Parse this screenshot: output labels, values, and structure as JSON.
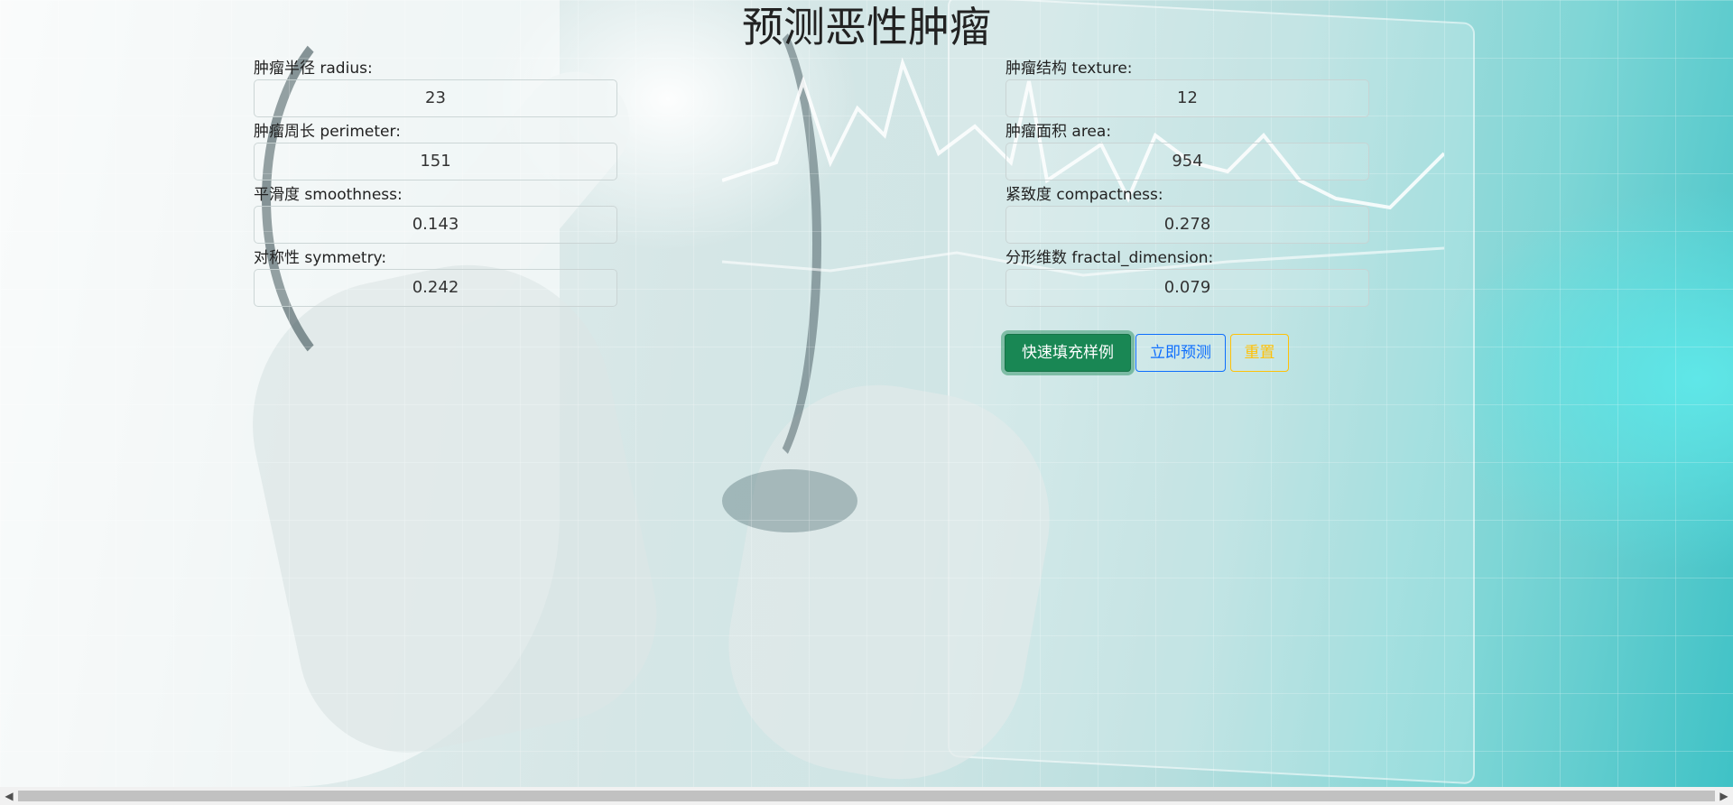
{
  "page": {
    "title": "预测恶性肿瘤"
  },
  "fields": [
    {
      "label": "肿瘤半径 radius:",
      "value": "23"
    },
    {
      "label": "肿瘤结构 texture:",
      "value": "12"
    },
    {
      "label": "肿瘤周长 perimeter:",
      "value": "151"
    },
    {
      "label": "肿瘤面积 area:",
      "value": "954"
    },
    {
      "label": "平滑度 smoothness:",
      "value": "0.143"
    },
    {
      "label": "紧致度 compactness:",
      "value": "0.278"
    },
    {
      "label": "对称性 symmetry:",
      "value": "0.242"
    },
    {
      "label": "分形维数 fractal_dimension:",
      "value": "0.079"
    }
  ],
  "buttons": {
    "fill_sample": "快速填充样例",
    "predict": "立即预测",
    "reset": "重置"
  },
  "scrollbar": {
    "left_arrow": "◀",
    "right_arrow": "▶"
  }
}
